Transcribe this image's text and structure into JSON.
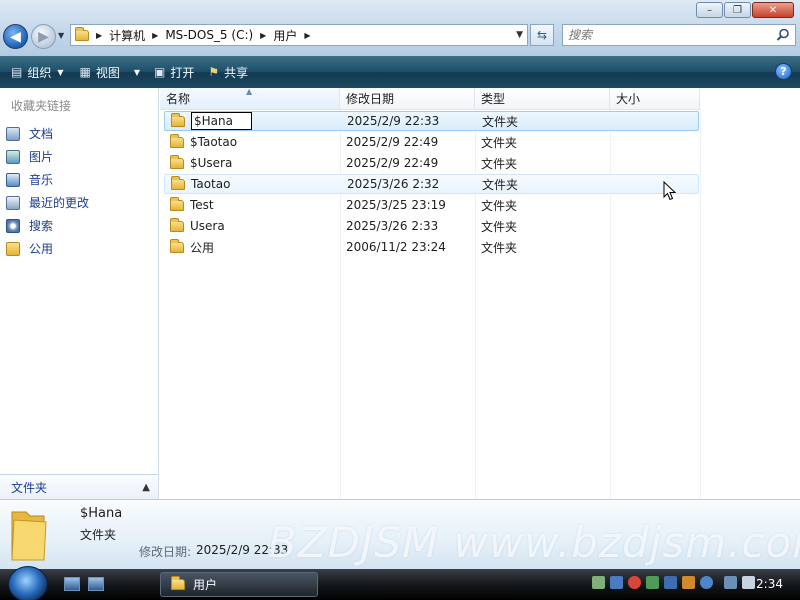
{
  "window": {
    "controls": {
      "minimize": "–",
      "maximize": "❐",
      "close": "✕"
    }
  },
  "address": {
    "crumbs": [
      "计算机",
      "MS-DOS_5 (C:)",
      "用户"
    ],
    "search_placeholder": "搜索"
  },
  "toolbar": {
    "organize": "组织",
    "views": "视图",
    "open": "打开",
    "share": "共享",
    "help": "?"
  },
  "navpane": {
    "heading": "收藏夹链接",
    "links": [
      {
        "label": "文档",
        "icon": "documents-icon"
      },
      {
        "label": "图片",
        "icon": "pictures-icon"
      },
      {
        "label": "音乐",
        "icon": "music-icon"
      },
      {
        "label": "最近的更改",
        "icon": "recent-changes-icon"
      },
      {
        "label": "搜索",
        "icon": "search-icon"
      },
      {
        "label": "公用",
        "icon": "folder-icon"
      }
    ],
    "folders_label": "文件夹"
  },
  "filelist": {
    "columns": [
      "名称",
      "修改日期",
      "类型",
      "大小"
    ],
    "sorted_column": "名称",
    "rows": [
      {
        "name": "$Hana",
        "date": "2025/2/9 22:33",
        "type": "文件夹",
        "state": "renaming"
      },
      {
        "name": "$Taotao",
        "date": "2025/2/9 22:49",
        "type": "文件夹",
        "state": ""
      },
      {
        "name": "$Usera",
        "date": "2025/2/9 22:49",
        "type": "文件夹",
        "state": ""
      },
      {
        "name": "Taotao",
        "date": "2025/3/26 2:32",
        "type": "文件夹",
        "state": "hover"
      },
      {
        "name": "Test",
        "date": "2025/3/25 23:19",
        "type": "文件夹",
        "state": ""
      },
      {
        "name": "Usera",
        "date": "2025/3/26 2:33",
        "type": "文件夹",
        "state": ""
      },
      {
        "name": "公用",
        "date": "2006/11/2 23:24",
        "type": "文件夹",
        "state": ""
      }
    ]
  },
  "details": {
    "name": "$Hana",
    "type": "文件夹",
    "date_label": "修改日期:",
    "date_value": "2025/2/9 22:33"
  },
  "watermark": "BZDJSM www.bzdjsm.com",
  "taskbar": {
    "task_label": "用户",
    "clock": "2:34"
  },
  "colors": {
    "accent_blue": "#1d5fb3",
    "command_bar": "#1f4f68",
    "selection": "#d9ecfb",
    "link": "#1d3e8c"
  }
}
